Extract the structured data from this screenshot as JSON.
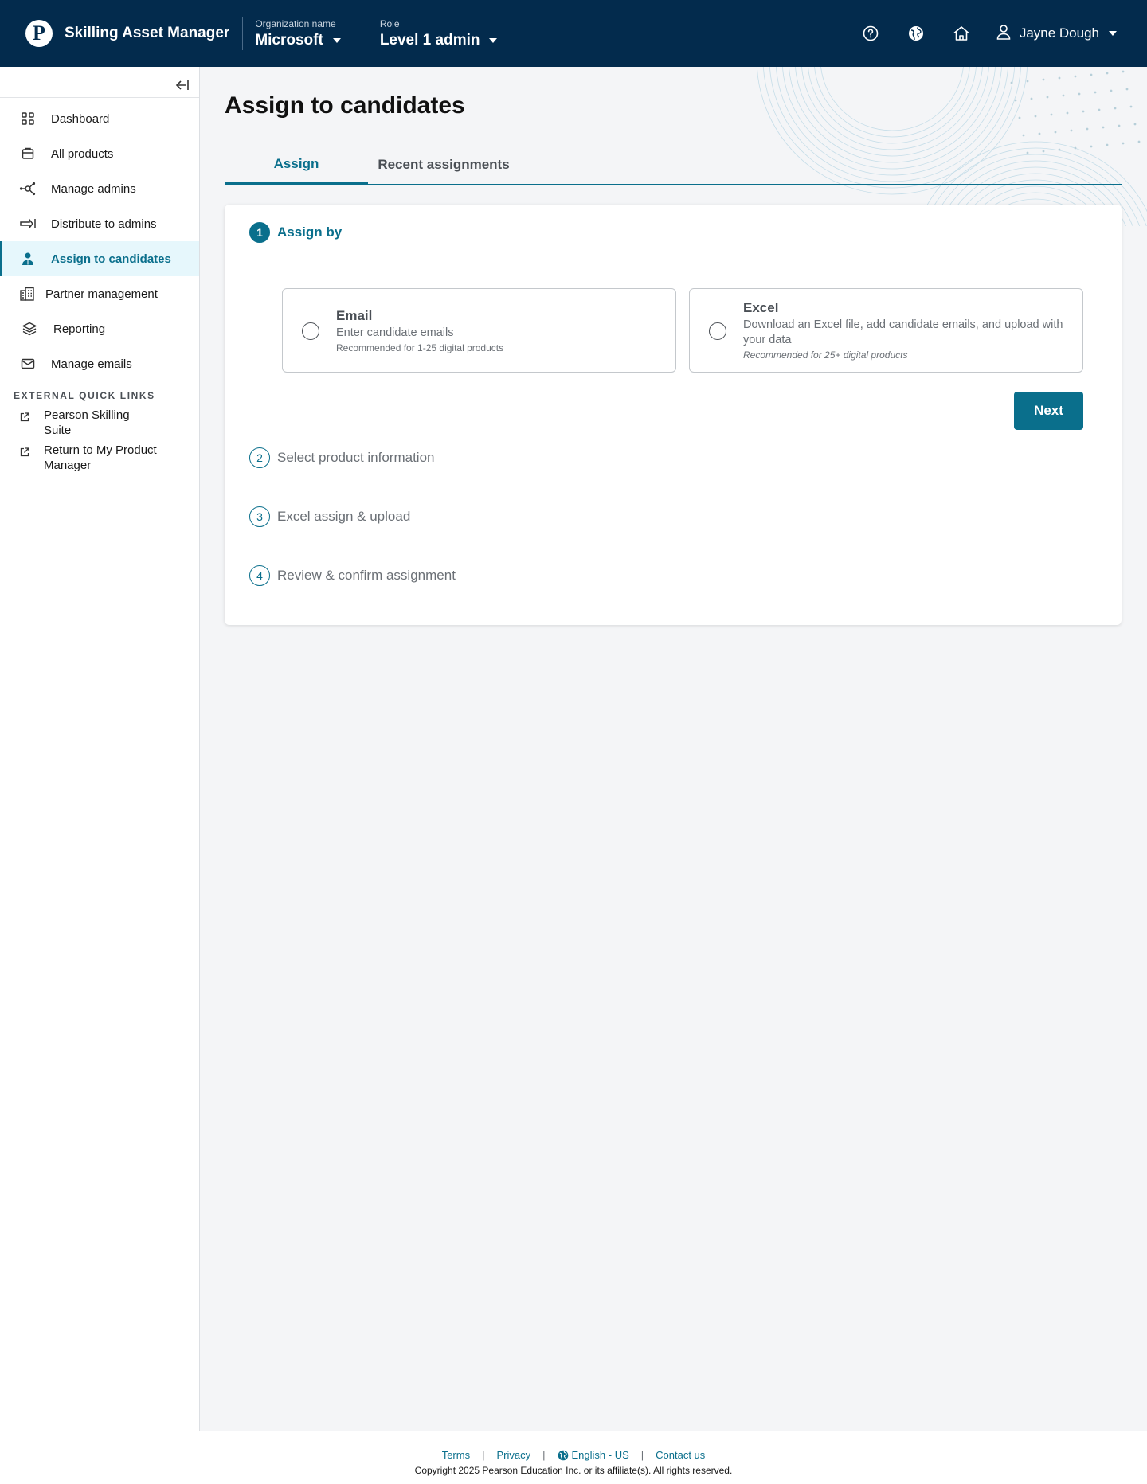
{
  "header": {
    "app_title": "Skilling Asset Manager",
    "org_label": "Organization name",
    "org_value": "Microsoft",
    "role_label": "Role",
    "role_value": "Level 1 admin",
    "user_name": "Jayne Dough",
    "icons": [
      "help-icon",
      "globe-icon",
      "home-icon",
      "user-icon"
    ],
    "bg_color": "#032b4d"
  },
  "sidebar": {
    "items": [
      {
        "label": "Dashboard",
        "icon": "grid-icon"
      },
      {
        "label": "All products",
        "icon": "box-icon"
      },
      {
        "label": "Manage admins",
        "icon": "network-icon"
      },
      {
        "label": "Distribute to admins",
        "icon": "arrow-right-bar-icon"
      },
      {
        "label": "Assign to candidates",
        "icon": "person-icon",
        "active": true
      },
      {
        "label": "Partner management",
        "icon": "building-icon"
      },
      {
        "label": "Reporting",
        "icon": "layers-icon"
      },
      {
        "label": "Manage emails",
        "icon": "mail-icon"
      }
    ],
    "external_heading": "EXTERNAL QUICK LINKS",
    "external_links": [
      {
        "label": "Pearson Skilling Suite",
        "icon": "external-link-icon"
      },
      {
        "label": "Return to My Product Manager",
        "icon": "external-link-icon"
      }
    ]
  },
  "main": {
    "title": "Assign to candidates",
    "tabs": [
      {
        "label": "Assign",
        "active": true
      },
      {
        "label": "Recent assignments"
      }
    ],
    "steps": [
      {
        "num": "1",
        "label": "Assign by",
        "active": true
      },
      {
        "num": "2",
        "label": "Select product information"
      },
      {
        "num": "3",
        "label": "Excel assign & upload"
      },
      {
        "num": "4",
        "label": "Review & confirm assignment"
      }
    ],
    "options": [
      {
        "title": "Email",
        "desc": "Enter candidate emails",
        "rec": "Recommended for 1-25 digital products"
      },
      {
        "title": "Excel",
        "desc": "Download an Excel file, add candidate emails, and upload with your data",
        "rec": "Recommended for 25+ digital products"
      }
    ],
    "next_label": "Next",
    "accent": "#0a6f8c"
  },
  "footer": {
    "links": [
      "Terms",
      "Privacy",
      "English - US",
      "Contact us"
    ],
    "copyright": "Copyright 2025 Pearson Education Inc. or its affiliate(s). All rights reserved."
  }
}
